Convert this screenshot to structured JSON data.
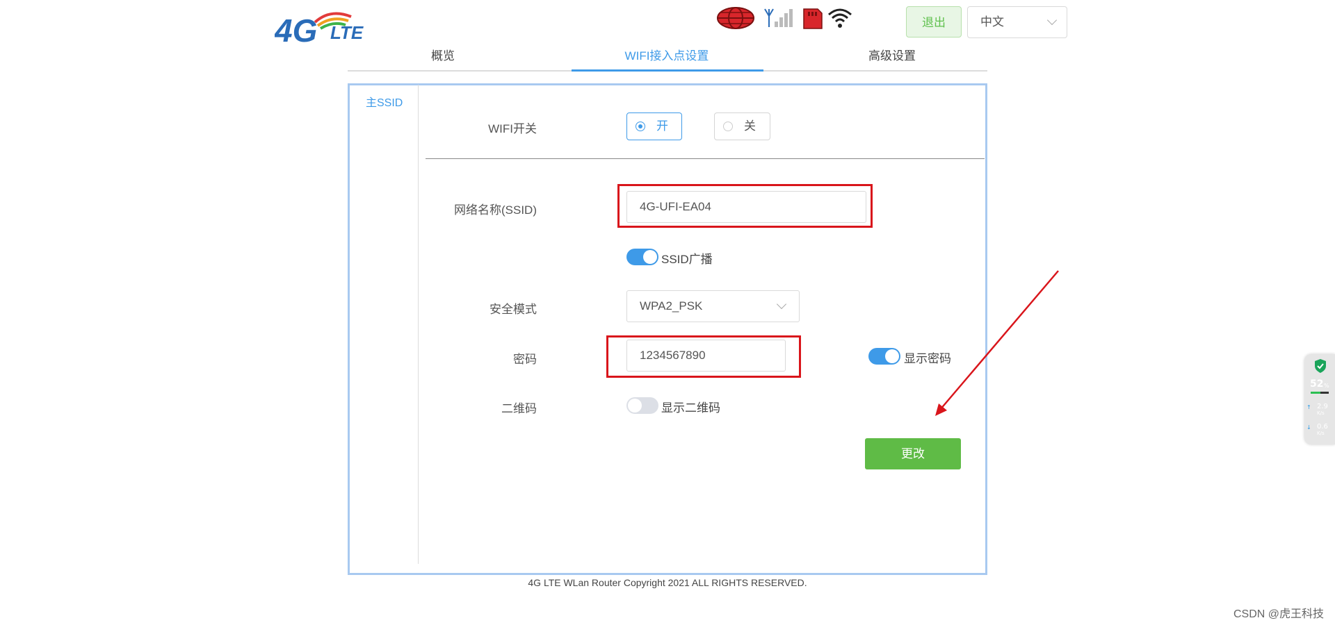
{
  "header": {
    "logo_text": "4GLTE",
    "logout_label": "退出",
    "language_value": "中文",
    "status_icons": [
      "globe-icon",
      "signal-icon",
      "sim-card-icon",
      "wifi-icon"
    ]
  },
  "tabs": [
    {
      "label": "概览",
      "active": false
    },
    {
      "label": "WIFI接入点设置",
      "active": true
    },
    {
      "label": "高级设置",
      "active": false
    }
  ],
  "side_tab": "主SSID",
  "form": {
    "wifi_switch_label": "WIFI开关",
    "wifi_on_label": "开",
    "wifi_off_label": "关",
    "wifi_enabled": true,
    "ssid_label": "网络名称(SSID)",
    "ssid_value": "4G-UFI-EA04",
    "ssid_broadcast_label": "SSID广播",
    "ssid_broadcast_on": true,
    "security_label": "安全模式",
    "security_value": "WPA2_PSK",
    "password_label": "密码",
    "password_value": "1234567890",
    "show_password_label": "显示密码",
    "show_password_on": true,
    "qrcode_label": "二维码",
    "show_qrcode_label": "显示二维码",
    "show_qrcode_on": false,
    "change_button": "更改"
  },
  "footer": "4G LTE WLan Router Copyright 2021 ALL RIGHTS RESERVED.",
  "net_widget": {
    "percent": "52",
    "percent_unit": "%",
    "upload": "2.9",
    "download": "0.6",
    "unit": "K/s"
  },
  "watermark": "CSDN @虎王科技",
  "colors": {
    "accent": "#3e9ae8",
    "button_green": "#5fbb46",
    "highlight_red": "#d9151b"
  }
}
